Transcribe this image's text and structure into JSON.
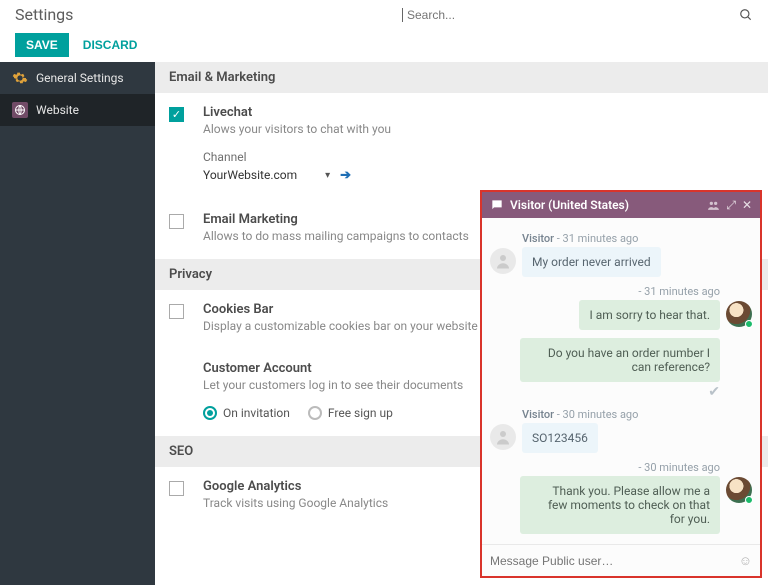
{
  "header": {
    "title": "Settings",
    "search_placeholder": "Search..."
  },
  "actions": {
    "save": "SAVE",
    "discard": "DISCARD"
  },
  "sidebar": {
    "items": [
      {
        "label": "General Settings",
        "selected": false
      },
      {
        "label": "Website",
        "selected": true
      }
    ]
  },
  "sections": {
    "email_marketing": {
      "header": "Email & Marketing",
      "livechat": {
        "checked": true,
        "title": "Livechat",
        "desc": "Alows your visitors to chat with you",
        "channel_label": "Channel",
        "channel_value": "YourWebsite.com"
      },
      "mailing": {
        "checked": false,
        "title": "Email Marketing",
        "desc": "Allows to do mass mailing campaigns to contacts"
      }
    },
    "privacy": {
      "header": "Privacy",
      "cookies": {
        "checked": false,
        "title": "Cookies Bar",
        "desc": "Display a customizable cookies bar on your website"
      },
      "customer_account": {
        "title": "Customer Account",
        "desc": "Let your customers log in to see their documents",
        "option_a": "On invitation",
        "option_b": "Free sign up",
        "selected": "a"
      }
    },
    "seo": {
      "header": "SEO",
      "ga": {
        "checked": false,
        "title": "Google Analytics",
        "desc": "Track visits using Google Analytics"
      }
    }
  },
  "chat": {
    "title": "Visitor (United States)",
    "input_placeholder": "Message Public user…",
    "messages": [
      {
        "side": "left",
        "name": "Visitor",
        "time": "31 minutes ago",
        "text": "My order never arrived"
      },
      {
        "side": "right",
        "time": "31 minutes ago",
        "text": "I am sorry to hear that."
      },
      {
        "side": "right",
        "text": "Do you have an order number I can reference?",
        "tick": true
      },
      {
        "side": "left",
        "name": "Visitor",
        "time": "30 minutes ago",
        "text": "SO123456"
      },
      {
        "side": "right",
        "time": "30 minutes ago",
        "text": "Thank you. Please allow me a few moments to check on that for you."
      }
    ]
  }
}
